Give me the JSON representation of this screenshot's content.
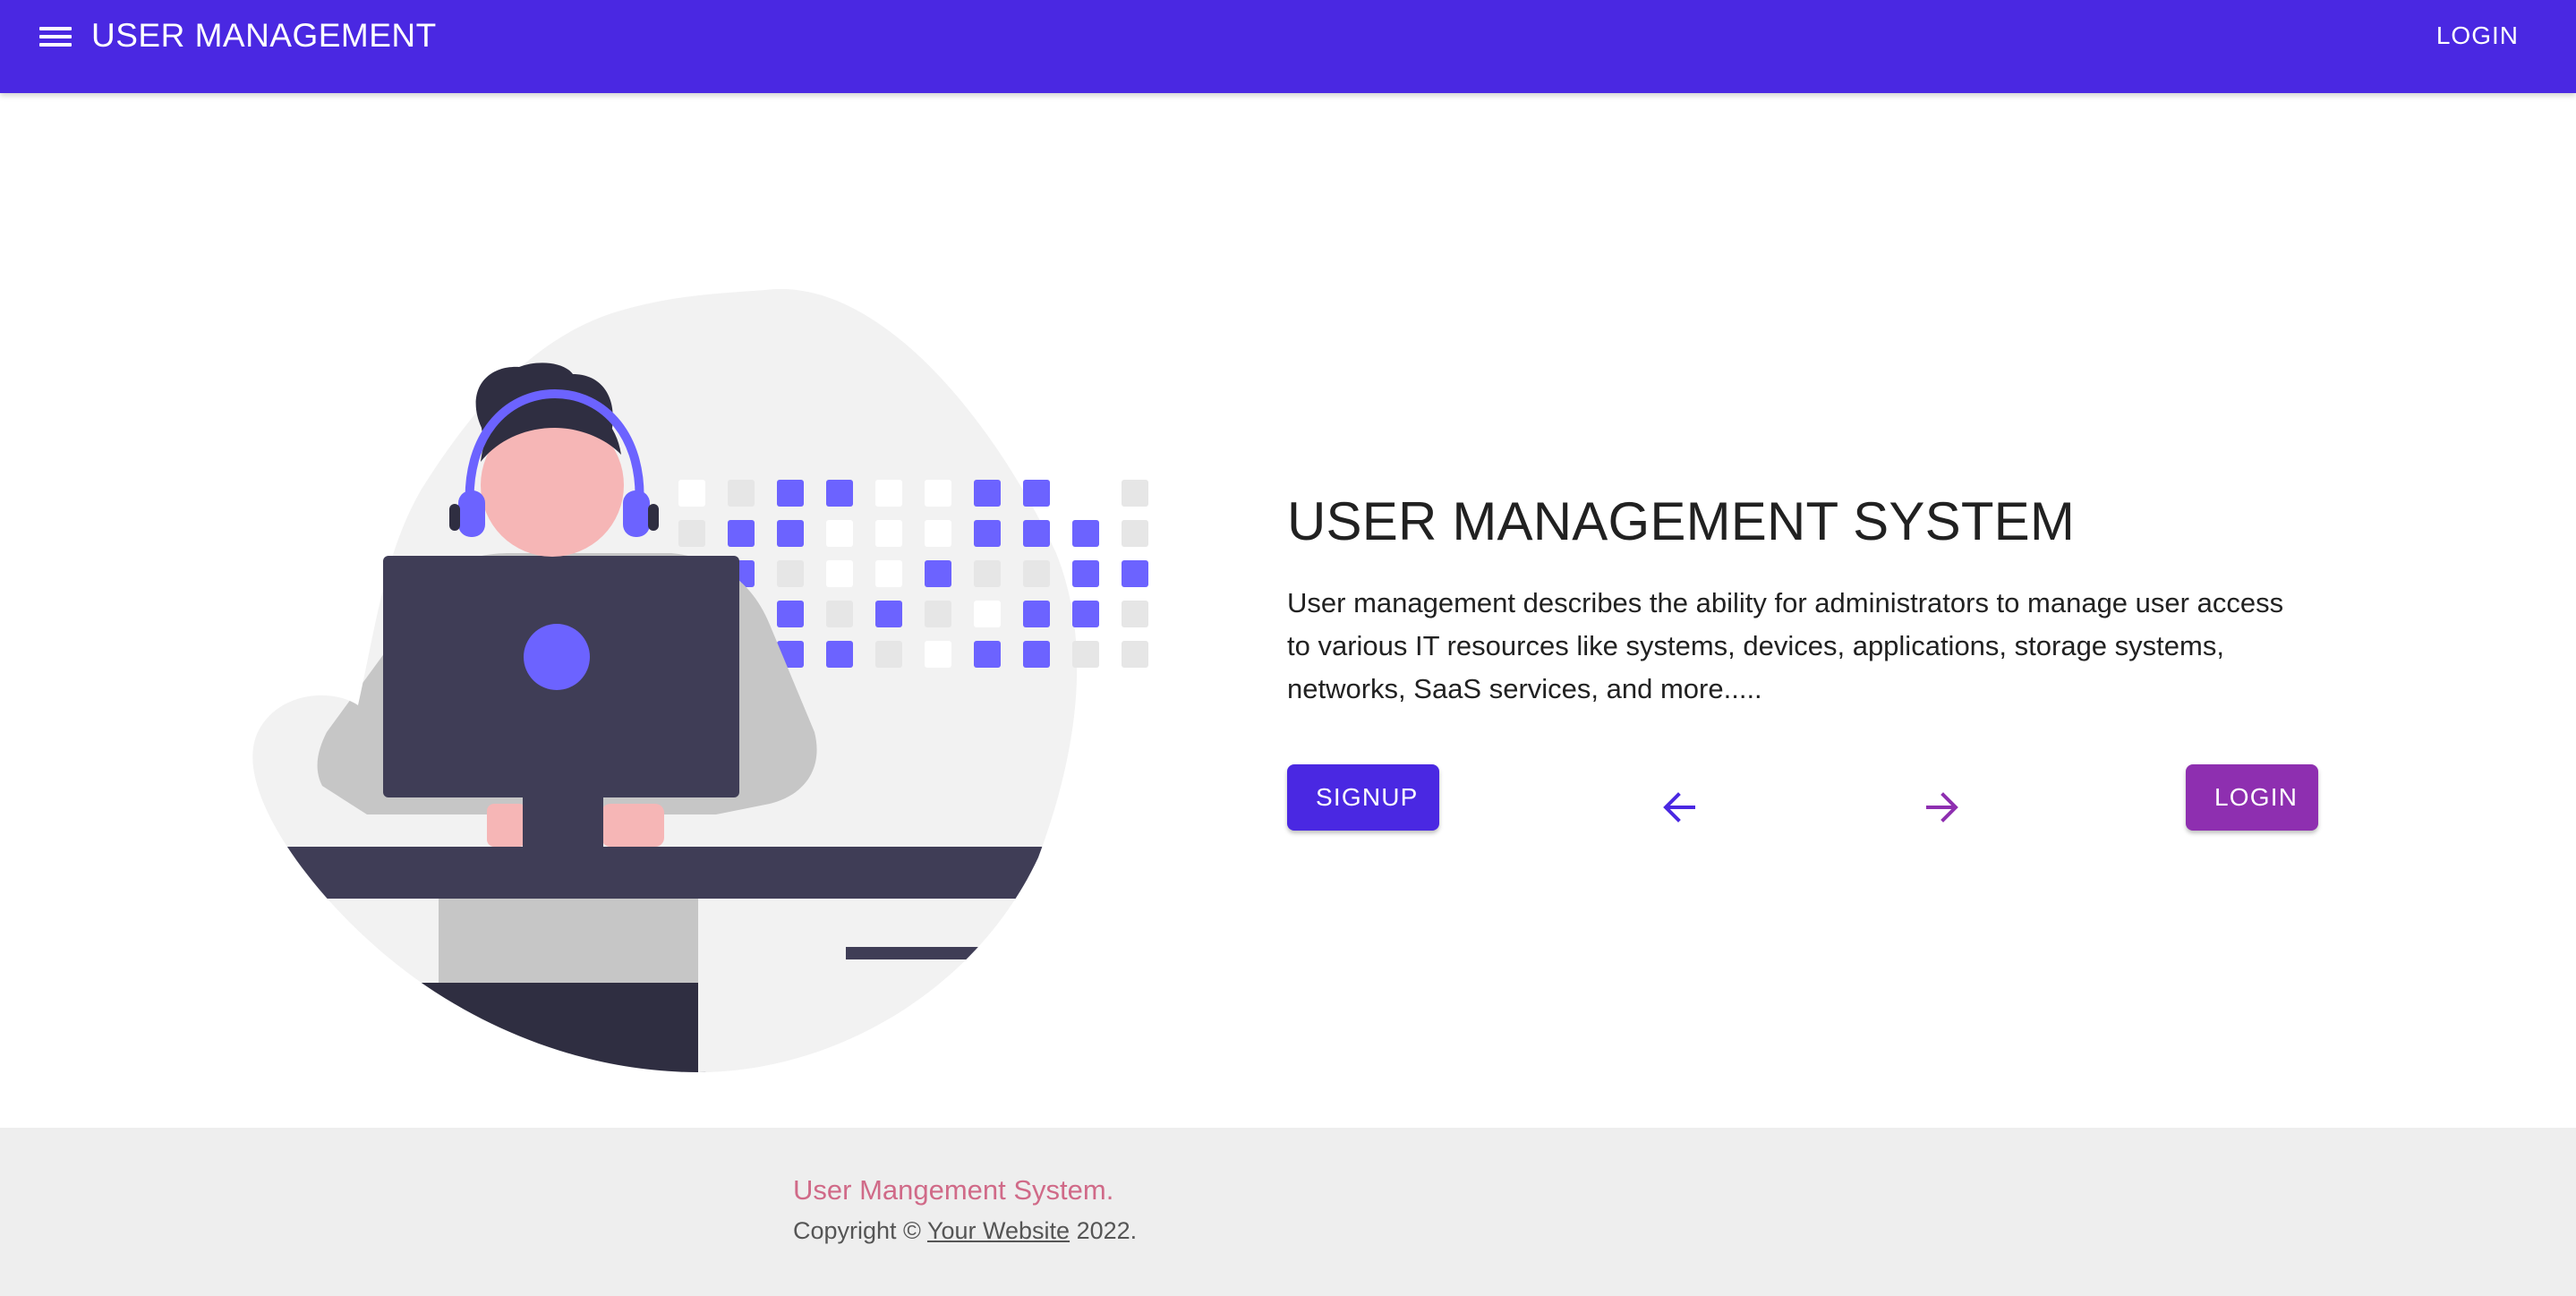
{
  "appbar": {
    "title": "USER MANAGEMENT",
    "login_label": "LOGIN",
    "menu_icon": "menu-icon",
    "background_color": "#4a28e2"
  },
  "hero": {
    "title": "USER MANAGEMENT SYSTEM",
    "description": "User management describes the ability for administrators to manage user access to various IT resources like systems, devices, applications, storage systems, networks, SaaS services, and more.....",
    "signup_label": "SIGNUP",
    "login_label": "LOGIN",
    "prev_icon": "arrow-left-icon",
    "next_icon": "arrow-right-icon",
    "signup_color": "#4a28e2",
    "login_color": "#8e2fb0"
  },
  "illustration": {
    "subject": "person-with-headset-at-computer-illustration",
    "accent_color": "#6c63ff"
  },
  "footer": {
    "brand": "User Mangement System.",
    "copyright_prefix": "Copyright © ",
    "link_text": "Your Website",
    "year_suffix": " 2022.",
    "brand_color": "#d06a88",
    "background_color": "#eeeeee"
  }
}
